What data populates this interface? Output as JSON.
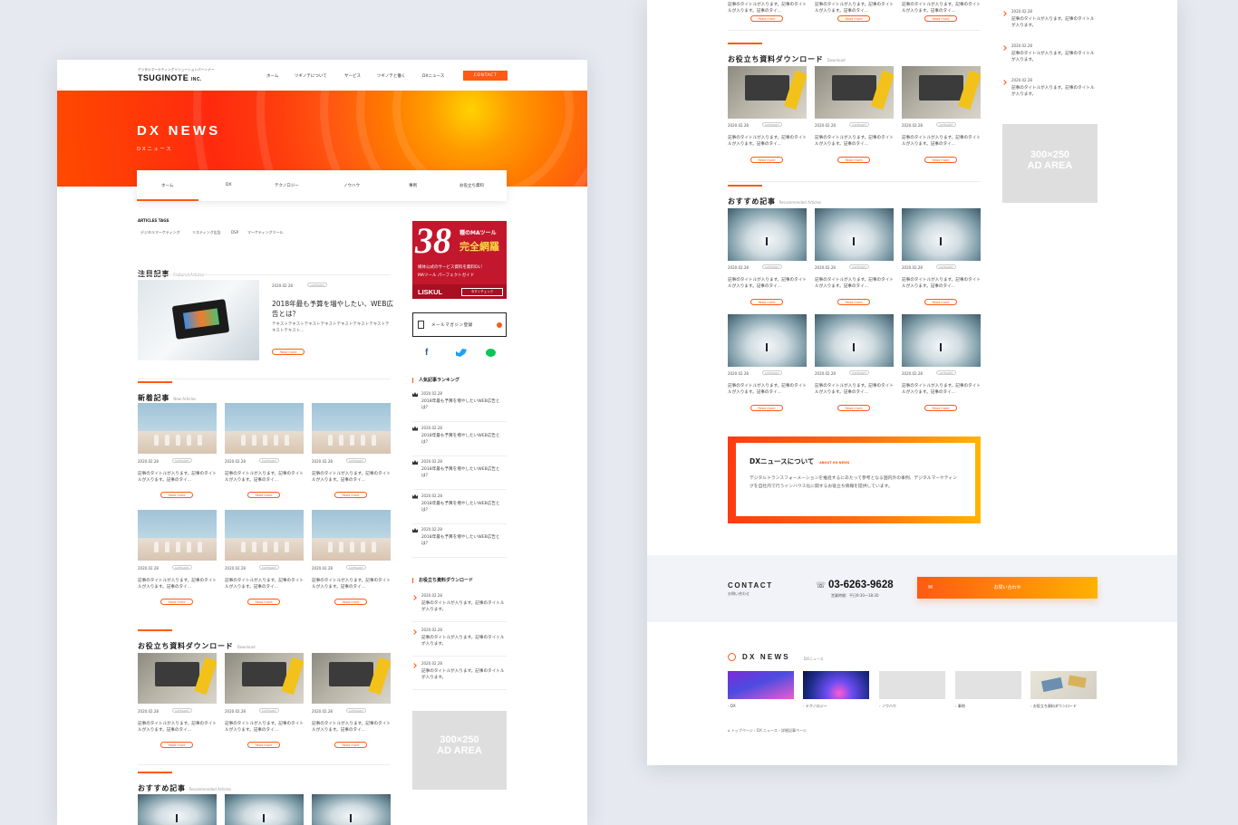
{
  "left_page": {
    "header": {
      "logo_sub": "デジタルマーケティングソリューションパートナー",
      "logo": "TSUGINOTE",
      "logo_suffix": "INC.",
      "nav": [
        "ホーム",
        "ツギノテについて",
        "サービス",
        "ツギノテと働く",
        "DXニュース"
      ],
      "contact": "CONTACT"
    },
    "hero": {
      "title": "DX NEWS",
      "subtitle": "DXニュース"
    },
    "subnav": [
      "ホーム",
      "DX",
      "テクノロジー",
      "ノウハウ",
      "事例",
      "お役立ち資料"
    ],
    "tags": {
      "label": "ARTICLES TAGS",
      "items": [
        "デジタルマーケティング",
        "リスティング広告",
        "DSP",
        "マーケティングツール"
      ]
    },
    "featured": {
      "heading": "注目記事",
      "heading_en": "Featured Articles",
      "date": "2020.02.28",
      "category": "CATEGORY",
      "title": "2018年最も予算を増やしたい、WEB広告とは？",
      "excerpt": "テキストテキストテキストテキストテキストテキストテキストテキストテキスト…",
      "read_more": "Read more"
    },
    "new_articles": {
      "heading": "新着記事",
      "heading_en": "New Articles",
      "date": "2020.02.28",
      "category": "CATEGORY",
      "title": "記事のタイトルが入ります。記事のタイトルが入ります。記事のタイ…",
      "read_more": "Read more"
    },
    "downloads": {
      "heading": "お役立ち資料ダウンロード",
      "heading_en": "Download",
      "date": "2020.02.28",
      "category": "CATEGORY",
      "title": "記事のタイトルが入ります。記事のタイトルが入ります。記事のタイ…",
      "read_more": "Read more"
    },
    "recommended": {
      "heading": "おすすめ記事",
      "heading_en": "Recommended Articles"
    },
    "sidebar": {
      "banner": {
        "number": "38",
        "line1": "種のMAツール",
        "line2": "完全網羅",
        "desc1": "媒体公式のサービス資料を無料DL！",
        "desc2": "MAツール パーフェクトガイド",
        "brand": "LISKUL",
        "btn": "今すぐチェック"
      },
      "newsletter": "メールマガジン登録",
      "ranking_heading": "人気記事ランキング",
      "ranking": [
        {
          "date": "2020.02.28",
          "title": "2018年最も予算を増やしたいWEB広告とは？"
        },
        {
          "date": "2020.02.28",
          "title": "2018年最も予算を増やしたいWEB広告とは？"
        },
        {
          "date": "2020.02.28",
          "title": "2018年最も予算を増やしたいWEB広告とは？"
        },
        {
          "date": "2020.02.28",
          "title": "2018年最も予算を増やしたいWEB広告とは？"
        },
        {
          "date": "2020.02.28",
          "title": "2018年最も予算を増やしたいWEB広告とは？"
        }
      ],
      "download_heading": "お役立ち資料ダウンロード",
      "download_items": [
        {
          "date": "2020.02.28",
          "title": "記事のタイトルが入ります。記事のタイトルが入ります。"
        },
        {
          "date": "2020.02.28",
          "title": "記事のタイトルが入ります。記事のタイトルが入ります。"
        },
        {
          "date": "2020.02.28",
          "title": "記事のタイトルが入ります。記事のタイトルが入ります。"
        }
      ],
      "ad": {
        "line1": "300×250",
        "line2": "AD AREA"
      }
    }
  },
  "right_page": {
    "card_title": "記事のタイトルが入ります。記事のタイトルが入ります。記事のタイ…",
    "read_more": "Read more",
    "date": "2020.02.28",
    "category": "CATEGORY",
    "downloads": {
      "heading": "お役立ち資料ダウンロード",
      "heading_en": "Download"
    },
    "recommended": {
      "heading": "おすすめ記事",
      "heading_en": "Recommended Articles"
    },
    "sidebar_items": [
      {
        "date": "2020.02.28",
        "title": "記事のタイトルが入ります。記事のタイトルが入ります。"
      },
      {
        "date": "2020.02.28",
        "title": "記事のタイトルが入ります。記事のタイトルが入ります。"
      },
      {
        "date": "2020.02.28",
        "title": "記事のタイトルが入ります。記事のタイトルが入ります。"
      }
    ],
    "ad": {
      "line1": "300×250",
      "line2": "AD AREA"
    },
    "about": {
      "title": "DXニュースについて",
      "title_en": "ABOUT DX NEWS",
      "body": "デジタルトランスフォーメーションを推進するにあたって参考となる国内外の事例、デジタルマーケティングを自社内で行うインハウス化に関するお役立ち情報を提供しています。"
    },
    "contact": {
      "title": "CONTACT",
      "sub": "お問い合わせ",
      "phone": "03-6263-9628",
      "hours": "営業時間：平日9:30〜18:30",
      "button": "お問い合わせ"
    },
    "footer": {
      "title": "DX NEWS",
      "sub": "DXニュース",
      "categories": [
        "DX",
        "テクノロジー",
        "ノウハウ",
        "事例",
        "お役立ち資料ダウンロード"
      ]
    },
    "breadcrumb": {
      "home": "トップページ",
      "mid": "DX ニュース",
      "current": "詳細記事ページ"
    }
  },
  "colors": {
    "accent": "#ff5a14",
    "accent_yellow": "#ffb400",
    "background": "#e6e9f0"
  }
}
